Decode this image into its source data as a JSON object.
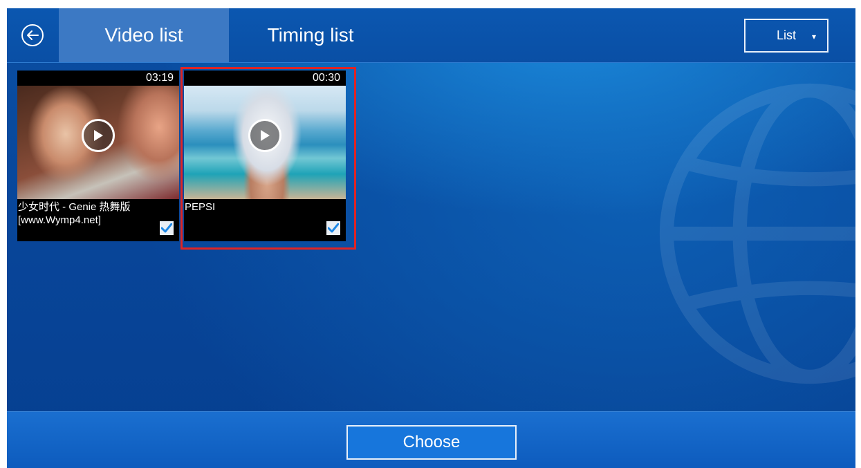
{
  "header": {
    "tabs": [
      {
        "label": "Video list",
        "active": true
      },
      {
        "label": "Timing list",
        "active": false
      }
    ],
    "view_select": {
      "label": "List"
    }
  },
  "videos": [
    {
      "title": "少女时代 - Genie 热舞版[www.Wymp4.net]",
      "duration": "03:19",
      "checked": true
    },
    {
      "title": "PEPSI",
      "duration": "00:30",
      "checked": true,
      "highlighted": true
    }
  ],
  "footer": {
    "choose_label": "Choose"
  },
  "colors": {
    "accent": "#1776dc",
    "header": "#0a4fa5",
    "active_tab": "#3c79c4",
    "highlight": "#e02424",
    "check": "#1e88e5"
  }
}
